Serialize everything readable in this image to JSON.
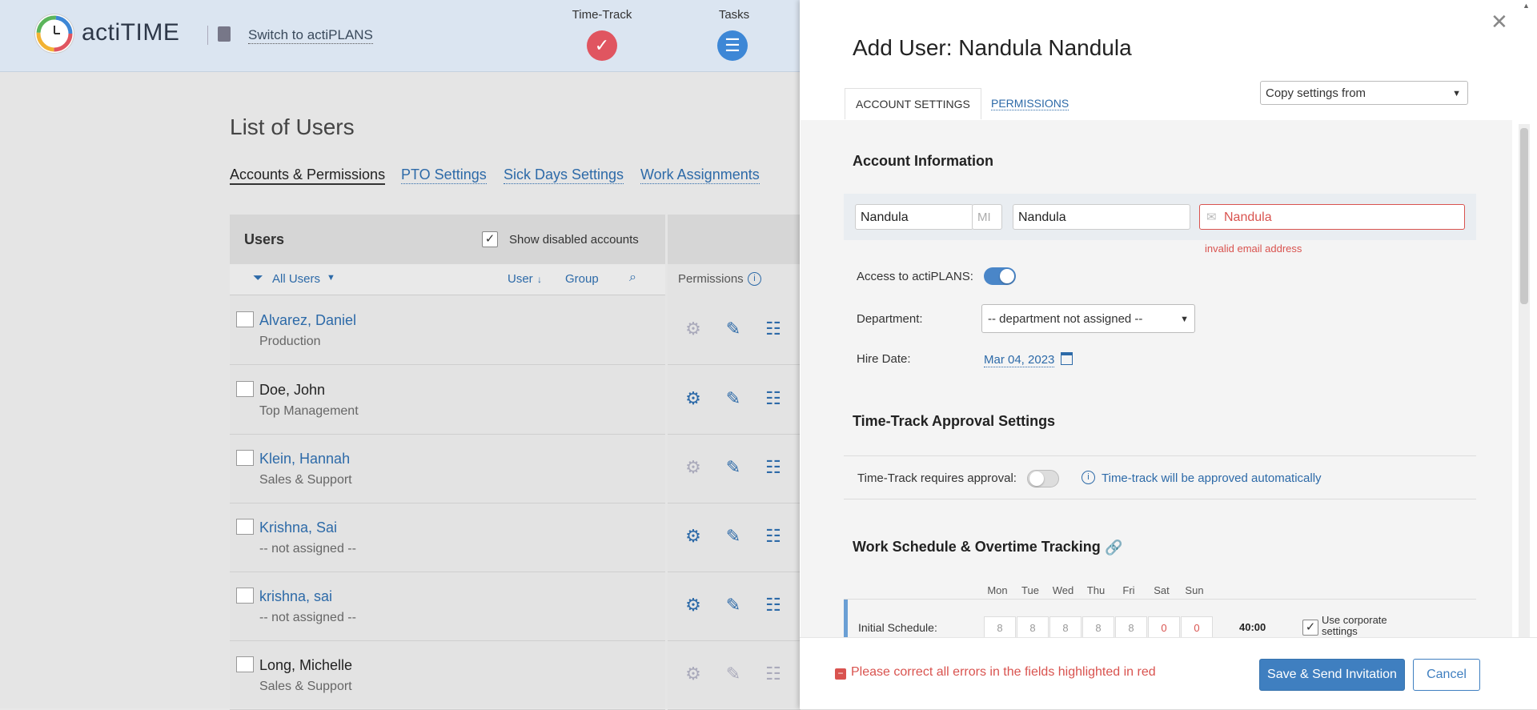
{
  "app": {
    "logo_text": "actiTIME",
    "switch_link": "Switch to actiPLANS",
    "nav": [
      {
        "label": "Time-Track",
        "color": "#e05560"
      },
      {
        "label": "Tasks",
        "color": "#3d87d6"
      }
    ]
  },
  "page": {
    "title": "List of Users",
    "subnav": [
      "Accounts & Permissions",
      "PTO Settings",
      "Sick Days Settings",
      "Work Assignments"
    ],
    "users_header": "Users",
    "show_disabled_label": "Show disabled accounts",
    "show_disabled_checked": true,
    "filter_label": "All Users",
    "sort_user": "User",
    "sort_group": "Group",
    "permissions_label": "Permissions",
    "users": [
      {
        "name": "Alvarez, Daniel",
        "dept": "Production",
        "linked": true
      },
      {
        "name": "Doe, John",
        "dept": "Top Management",
        "linked": false
      },
      {
        "name": "Klein, Hannah",
        "dept": "Sales & Support",
        "linked": true
      },
      {
        "name": "Krishna, Sai",
        "dept": "-- not assigned --",
        "linked": true
      },
      {
        "name": "krishna, sai",
        "dept": "-- not assigned --",
        "linked": true
      },
      {
        "name": "Long, Michelle",
        "dept": "Sales & Support",
        "linked": false
      }
    ]
  },
  "modal": {
    "title": "Add User: Nandula Nandula",
    "tabs": [
      "ACCOUNT SETTINGS",
      "PERMISSIONS"
    ],
    "copy_settings": "Copy settings from",
    "account_section": "Account Information",
    "first_name": "Nandula",
    "mi_placeholder": "MI",
    "last_name": "Nandula",
    "email_value": "Nandula",
    "email_error": "invalid email address",
    "access_label": "Access to actiPLANS:",
    "access_on": true,
    "department_label": "Department:",
    "department_value": "-- department not assigned --",
    "hire_date_label": "Hire Date:",
    "hire_date_value": "Mar 04, 2023",
    "approval_section": "Time-Track Approval Settings",
    "approval_label": "Time-Track requires approval:",
    "approval_on": false,
    "approval_info": "Time-track will be approved automatically",
    "schedule_section": "Work Schedule & Overtime Tracking",
    "days": [
      "Mon",
      "Tue",
      "Wed",
      "Thu",
      "Fri",
      "Sat",
      "Sun"
    ],
    "initial_schedule_label": "Initial Schedule:",
    "schedule_values": [
      "8",
      "8",
      "8",
      "8",
      "8",
      "0",
      "0"
    ],
    "schedule_total": "40:00",
    "use_corporate_label": "Use corporate settings",
    "use_corporate_checked": true,
    "footer_error": "Please correct all errors in the fields highlighted in red",
    "save_button": "Save & Send Invitation",
    "cancel_button": "Cancel"
  }
}
